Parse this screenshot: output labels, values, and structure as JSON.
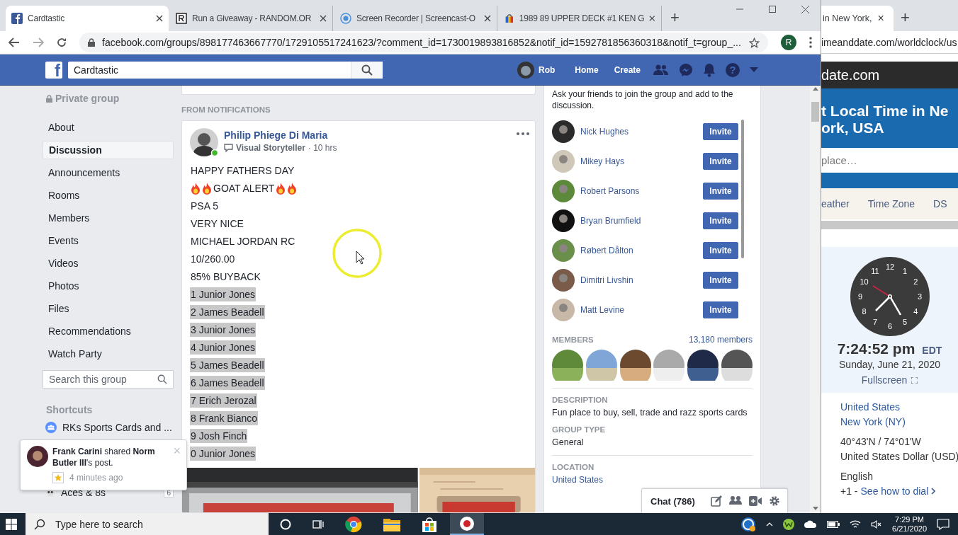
{
  "browser_left": {
    "tabs": [
      {
        "title": "Cardtastic",
        "kind": "facebook",
        "selected": true
      },
      {
        "title": "Run a Giveaway - RANDOM.OR",
        "kind": "random",
        "selected": false
      },
      {
        "title": "Screen Recorder | Screencast-O",
        "kind": "recorder",
        "selected": false
      },
      {
        "title": "1989 89 UPPER DECK #1 KEN G",
        "kind": "shop",
        "selected": false
      }
    ],
    "new_tab": "+",
    "address": "facebook.com/groups/898177463667770/1729105517241623/?comment_id=1730019893816852&notif_id=1592781856360318&notif_t=group_...",
    "profile_initial": "R"
  },
  "facebook": {
    "logo": "f",
    "search_value": "Cardtastic",
    "user": "Rob",
    "nav": [
      "Home",
      "Create"
    ],
    "help": "?"
  },
  "sidebar": {
    "privacy": "Private group",
    "items": [
      {
        "label": "About",
        "selected": false
      },
      {
        "label": "Discussion",
        "selected": true
      },
      {
        "label": "Announcements",
        "selected": false
      },
      {
        "label": "Rooms",
        "selected": false
      },
      {
        "label": "Members",
        "selected": false
      },
      {
        "label": "Events",
        "selected": false
      },
      {
        "label": "Videos",
        "selected": false
      },
      {
        "label": "Photos",
        "selected": false
      },
      {
        "label": "Files",
        "selected": false
      },
      {
        "label": "Recommendations",
        "selected": false
      },
      {
        "label": "Watch Party",
        "selected": false
      }
    ],
    "search_placeholder": "Search this group",
    "shortcuts_title": "Shortcuts",
    "shortcuts": [
      {
        "label": "RKs Sports Cards and ...",
        "kind": "group"
      },
      {
        "label": "Aces & 8s",
        "kind": "skull",
        "badge": "6"
      }
    ]
  },
  "feed": {
    "section": "FROM NOTIFICATIONS",
    "post": {
      "author": "Philip Phiege Di Maria",
      "badge": "Visual Storyteller",
      "time": "· 10 hrs",
      "lines": [
        {
          "text": "HAPPY FATHERS DAY",
          "kind": "plain",
          "highlighted": false
        },
        {
          "text": "GOAT ALERT",
          "kind": "fire",
          "highlighted": false
        },
        {
          "text": "PSA 5",
          "kind": "plain",
          "highlighted": false
        },
        {
          "text": "VERY NICE",
          "kind": "plain",
          "highlighted": false
        },
        {
          "text": "MICHAEL JORDAN RC",
          "kind": "plain",
          "highlighted": false
        },
        {
          "text": "10/260.00",
          "kind": "plain",
          "highlighted": false
        },
        {
          "text": "85% BUYBACK",
          "kind": "plain",
          "highlighted": false
        },
        {
          "text": "1 Junior Jones",
          "kind": "plain",
          "highlighted": true
        },
        {
          "text": "2 James Beadell",
          "kind": "plain",
          "highlighted": true
        },
        {
          "text": "3 Junior Jones",
          "kind": "plain",
          "highlighted": true
        },
        {
          "text": "4 Junior Jones",
          "kind": "plain",
          "highlighted": true
        },
        {
          "text": "5 James Beadell",
          "kind": "plain",
          "highlighted": true
        },
        {
          "text": "6 James Beadell",
          "kind": "plain",
          "highlighted": true
        },
        {
          "text": "7 Erich Jerozal",
          "kind": "plain",
          "highlighted": true
        },
        {
          "text": "8 Frank Bianco",
          "kind": "plain",
          "highlighted": true
        },
        {
          "text": "9 Josh Finch",
          "kind": "plain",
          "highlighted": true
        },
        {
          "text": "0 Junior Jones",
          "kind": "plain",
          "highlighted": true
        }
      ]
    }
  },
  "notification": {
    "text": "**Frank Carini** shared **Norm Butler III**'s post.",
    "time": "4 minutes ago",
    "close": "×"
  },
  "group_info": {
    "invite_prompt": "Ask your friends to join the group and add to the discussion.",
    "friends": [
      {
        "name": "Nick Hughes",
        "action": "Invite"
      },
      {
        "name": "Mikey Hays",
        "action": "Invite"
      },
      {
        "name": "Robert Parsons",
        "action": "Invite"
      },
      {
        "name": "Bryan Brumfield",
        "action": "Invite"
      },
      {
        "name": "Røbert Dålton",
        "action": "Invite"
      },
      {
        "name": "Dimitri Livshin",
        "action": "Invite"
      },
      {
        "name": "Matt Levine",
        "action": "Invite"
      }
    ],
    "members_title": "MEMBERS",
    "members_count": "13,180 members",
    "sections": [
      {
        "title": "DESCRIPTION",
        "value": "Fun place to buy, sell, trade and razz sports cards",
        "kind": "text",
        "divided": true
      },
      {
        "title": "GROUP TYPE",
        "value": "General",
        "kind": "text",
        "divided": false
      },
      {
        "title": "LOCATION",
        "value": "United States",
        "kind": "link",
        "divided": true
      }
    ]
  },
  "chat": {
    "label": "Chat (786)"
  },
  "browser_right": {
    "tab_title": "in New York,",
    "close": "×",
    "new_tab": "+",
    "address": "imeanddate.com/worldclock/us",
    "site": "date.com",
    "headline": [
      "t Local Time in Ne",
      "ork, USA"
    ],
    "search_placeholder": "place…",
    "nav": [
      "eather",
      "Time Zone",
      "DS"
    ],
    "dial": [
      "12",
      "1",
      "2",
      "3",
      "4",
      "5",
      "6",
      "7",
      "8",
      "9",
      "10",
      "11"
    ],
    "time": "7:24:52 pm",
    "zone": "EDT",
    "date": "Sunday, June 21, 2020",
    "fullscreen": "Fullscreen",
    "info": [
      [
        {
          "text": "United States",
          "kind": "link"
        },
        {
          "text": "New York (NY)",
          "kind": "link"
        }
      ],
      [
        {
          "text": "40°43'N / 74°01'W",
          "kind": "text"
        },
        {
          "text": "United States Dollar (USD)",
          "kind": "text"
        }
      ],
      [
        {
          "text": "English",
          "kind": "text"
        },
        {
          "prefix": "+1 -",
          "text": "See how to dial",
          "kind": "link"
        }
      ]
    ]
  },
  "taskbar": {
    "search_placeholder": "Type here to search",
    "time": "7:29 PM",
    "date": "6/21/2020"
  }
}
